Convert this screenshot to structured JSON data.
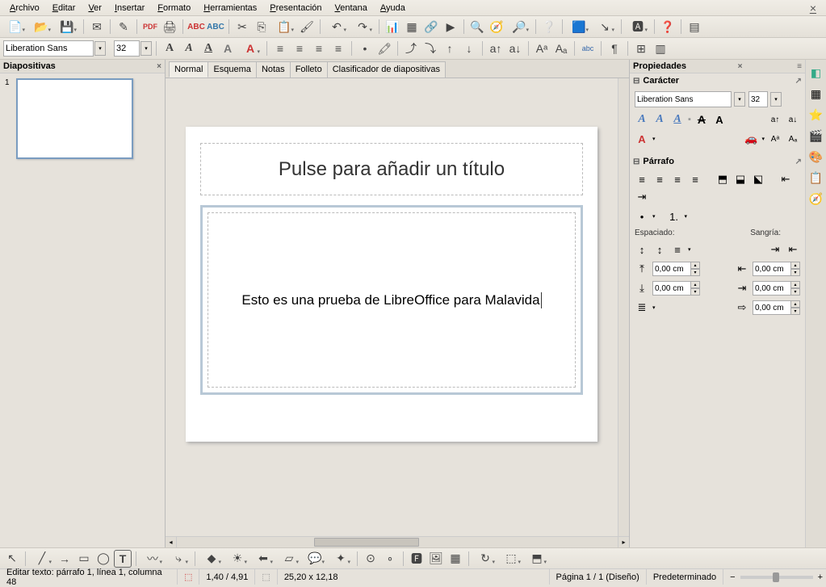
{
  "menu": {
    "archivo": "Archivo",
    "editar": "Editar",
    "ver": "Ver",
    "insertar": "Insertar",
    "formato": "Formato",
    "herramientas": "Herramientas",
    "presentacion": "Presentación",
    "ventana": "Ventana",
    "ayuda": "Ayuda"
  },
  "font": {
    "name": "Liberation Sans",
    "size": "32"
  },
  "slides_panel": {
    "title": "Diapositivas",
    "slide1_num": "1"
  },
  "view_tabs": {
    "normal": "Normal",
    "esquema": "Esquema",
    "notas": "Notas",
    "folleto": "Folleto",
    "clasificador": "Clasificador de diapositivas"
  },
  "slide": {
    "title_placeholder": "Pulse para añadir un título",
    "content": "Esto es una prueba de LibreOffice para Malavida"
  },
  "props": {
    "title": "Propiedades",
    "caracter": "Carácter",
    "font_name": "Liberation Sans",
    "font_size": "32",
    "parrafo": "Párrafo",
    "espaciado": "Espaciado:",
    "sangria": "Sangría:",
    "sp1": "0,00 cm",
    "sp2": "0,00 cm",
    "sp3": "0,00 cm",
    "sp4": "0,00 cm",
    "sp5": "0,00 cm"
  },
  "status": {
    "edit": "Editar texto: párrafo 1, línea 1, columna 48",
    "pos": "1,40 / 4,91",
    "size": "25,20 x 12,18",
    "page": "Página 1 / 1 (Diseño)",
    "style": "Predeterminado"
  }
}
